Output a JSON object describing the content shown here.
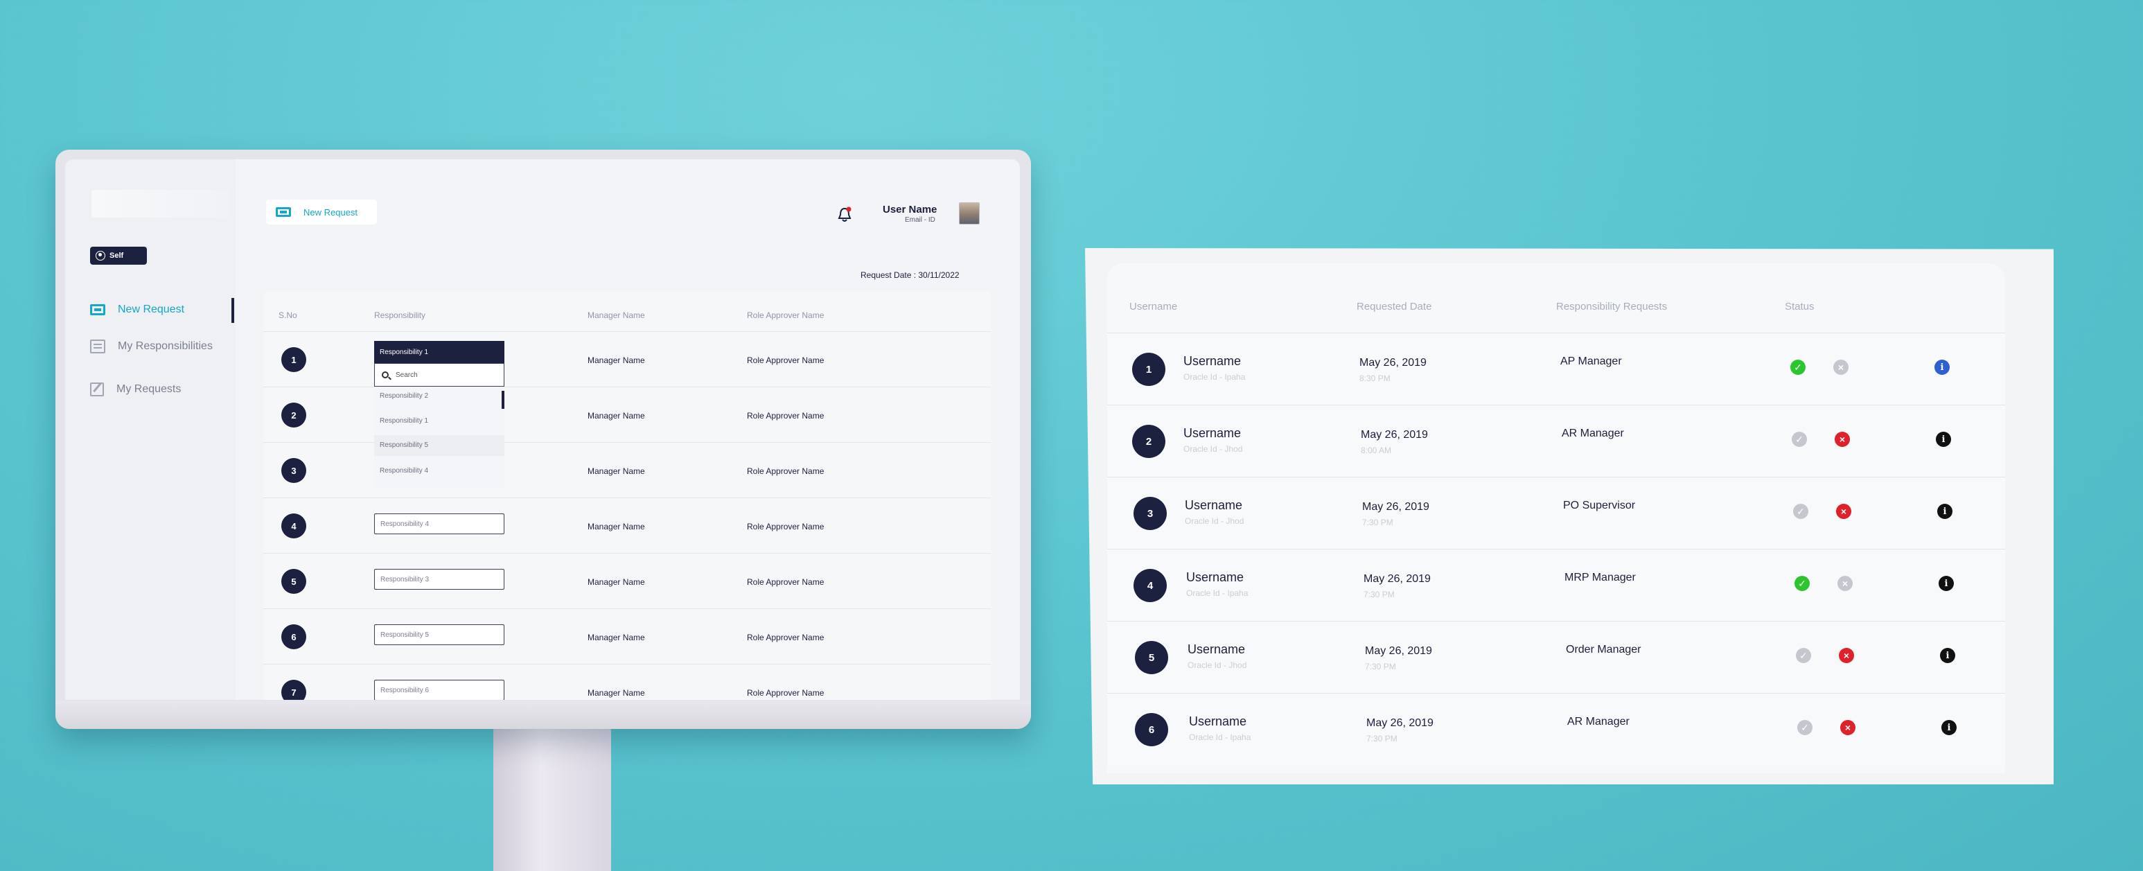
{
  "monitor": {
    "sidebar": {
      "badge": "Self",
      "items": [
        {
          "label": "New Request",
          "icon": "new-request-icon",
          "active": true
        },
        {
          "label": "My Responsibilities",
          "icon": "responsibilities-icon",
          "active": false
        },
        {
          "label": "My Requests",
          "icon": "edit-icon",
          "active": false
        }
      ]
    },
    "header": {
      "chip_label": "New Request",
      "user_name": "User Name",
      "user_email": "Email - ID",
      "request_date": "Request Date : 30/11/2022"
    },
    "table": {
      "columns": [
        "S.No",
        "Responsibility",
        "Manager Name",
        "Role Approver Name"
      ],
      "rows": [
        {
          "num": "1",
          "responsibility": "Responsibility 1",
          "manager": "Manager Name",
          "approver": "Role Approver Name"
        },
        {
          "num": "2",
          "responsibility": "",
          "manager": "Manager Name",
          "approver": "Role Approver Name"
        },
        {
          "num": "3",
          "responsibility": "",
          "manager": "Manager Name",
          "approver": "Role Approver Name"
        },
        {
          "num": "4",
          "responsibility": "Responsibility 4",
          "manager": "Manager Name",
          "approver": "Role Approver Name"
        },
        {
          "num": "5",
          "responsibility": "Responsibility 3",
          "manager": "Manager Name",
          "approver": "Role Approver Name"
        },
        {
          "num": "6",
          "responsibility": "Responsibility 5",
          "manager": "Manager Name",
          "approver": "Role Approver Name"
        },
        {
          "num": "7",
          "responsibility": "Responsibility 6",
          "manager": "Manager Name",
          "approver": "Role Approver Name"
        }
      ]
    },
    "dropdown": {
      "selected": "Responsibility 1",
      "search_placeholder": "Search",
      "options": [
        "Responsibility 2",
        "Responsibility 1",
        "Responsibility 5",
        "Responsibility 4"
      ]
    }
  },
  "panel": {
    "columns": [
      "Username",
      "Requested Date",
      "Responsibility Requests",
      "Status"
    ],
    "rows": [
      {
        "num": "1",
        "user": "Username",
        "sub": "Oracle Id - Ipaha",
        "date": "May 26, 2019",
        "time": "8:30 PM",
        "resp": "AP Manager",
        "status": "approved",
        "info": "blue"
      },
      {
        "num": "2",
        "user": "Username",
        "sub": "Oracle Id - Jhod",
        "date": "May 26, 2019",
        "time": "8:00 AM",
        "resp": "AR Manager",
        "status": "rejected",
        "info": "black"
      },
      {
        "num": "3",
        "user": "Username",
        "sub": "Oracle Id - Jhod",
        "date": "May 26, 2019",
        "time": "7:30 PM",
        "resp": "PO Supervisor",
        "status": "rejected",
        "info": "black"
      },
      {
        "num": "4",
        "user": "Username",
        "sub": "Oracle Id - Ipaha",
        "date": "May 26, 2019",
        "time": "7:30 PM",
        "resp": "MRP Manager",
        "status": "approved",
        "info": "black"
      },
      {
        "num": "5",
        "user": "Username",
        "sub": "Oracle Id - Jhod",
        "date": "May 26, 2019",
        "time": "7:30 PM",
        "resp": "Order Manager",
        "status": "rejected",
        "info": "black"
      },
      {
        "num": "6",
        "user": "Username",
        "sub": "Oracle Id - Ipaha",
        "date": "May 26, 2019",
        "time": "7:30 PM",
        "resp": "AR Manager",
        "status": "rejected",
        "info": "black"
      }
    ]
  },
  "colors": {
    "accent": "#15a7c9",
    "navy": "#1d2140",
    "approved": "#2bc52f",
    "rejected": "#e0202a",
    "info_blue": "#2f5fd0"
  }
}
